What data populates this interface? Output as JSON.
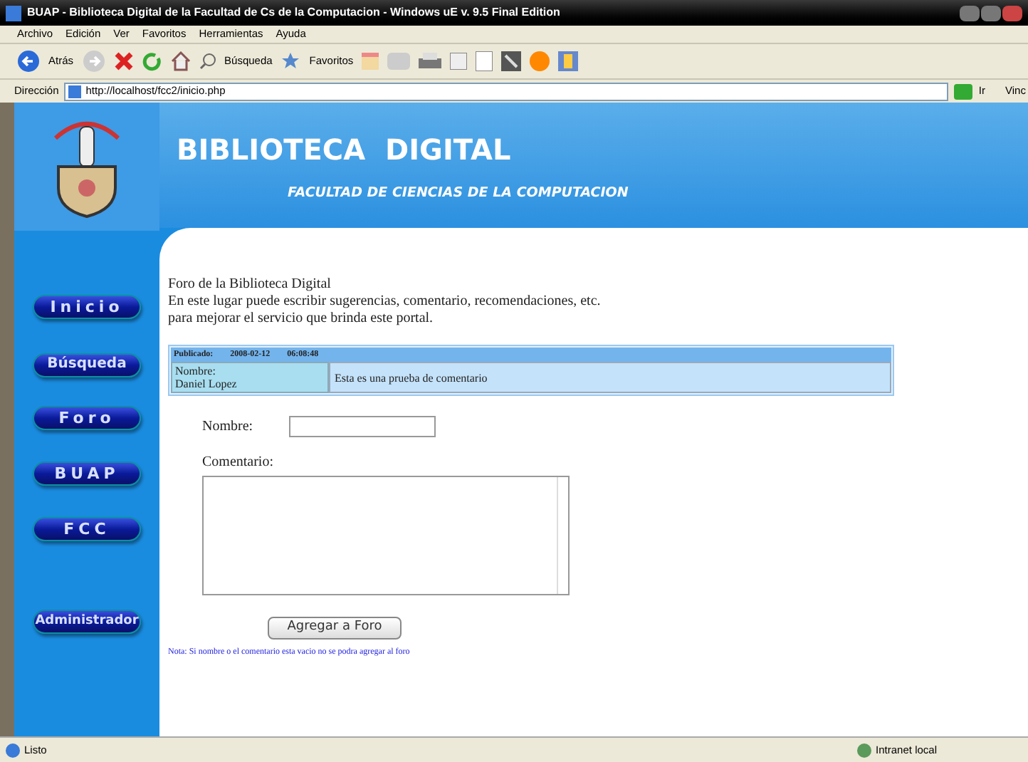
{
  "window": {
    "title": "BUAP - Biblioteca Digital de la Facultad de Cs de la Computacion - Windows uE v. 9.5 Final Edition"
  },
  "menu": [
    "Archivo",
    "Edición",
    "Ver",
    "Favoritos",
    "Herramientas",
    "Ayuda"
  ],
  "toolbar": {
    "back": "Atrás",
    "search": "Búsqueda",
    "favorites": "Favoritos"
  },
  "address_bar": {
    "label": "Dirección",
    "url": "http://localhost/fcc2/inicio.php",
    "go": "Ir",
    "links": "Vinc"
  },
  "header": {
    "title": "BIBLIOTECA  DIGITAL",
    "subtitle": "FACULTAD DE CIENCIAS DE LA COMPUTACION"
  },
  "nav": [
    {
      "label": "Inicio"
    },
    {
      "label": "Búsqueda"
    },
    {
      "label": "Foro"
    },
    {
      "label": "BUAP"
    },
    {
      "label": "FCC"
    },
    {
      "label": "Administrador"
    }
  ],
  "intro": [
    "Foro de la Biblioteca Digital",
    "En este lugar puede escribir sugerencias, comentario, recomendaciones, etc.",
    "para mejorar el servicio que brinda este portal."
  ],
  "posts": [
    {
      "published_label": "Publicado:",
      "date": "2008-02-12",
      "time": "06:08:48",
      "name_label": "Nombre:",
      "name": "Daniel Lopez",
      "comment": "Esta es una prueba de comentario"
    }
  ],
  "form": {
    "name_label": "Nombre:",
    "comment_label": "Comentario:",
    "submit": "Agregar a Foro",
    "note": "Nota:  Si nombre o el comentario esta vacio no se podra agregar al foro"
  },
  "status_bar": {
    "status": "Listo",
    "zone": "Intranet local"
  }
}
